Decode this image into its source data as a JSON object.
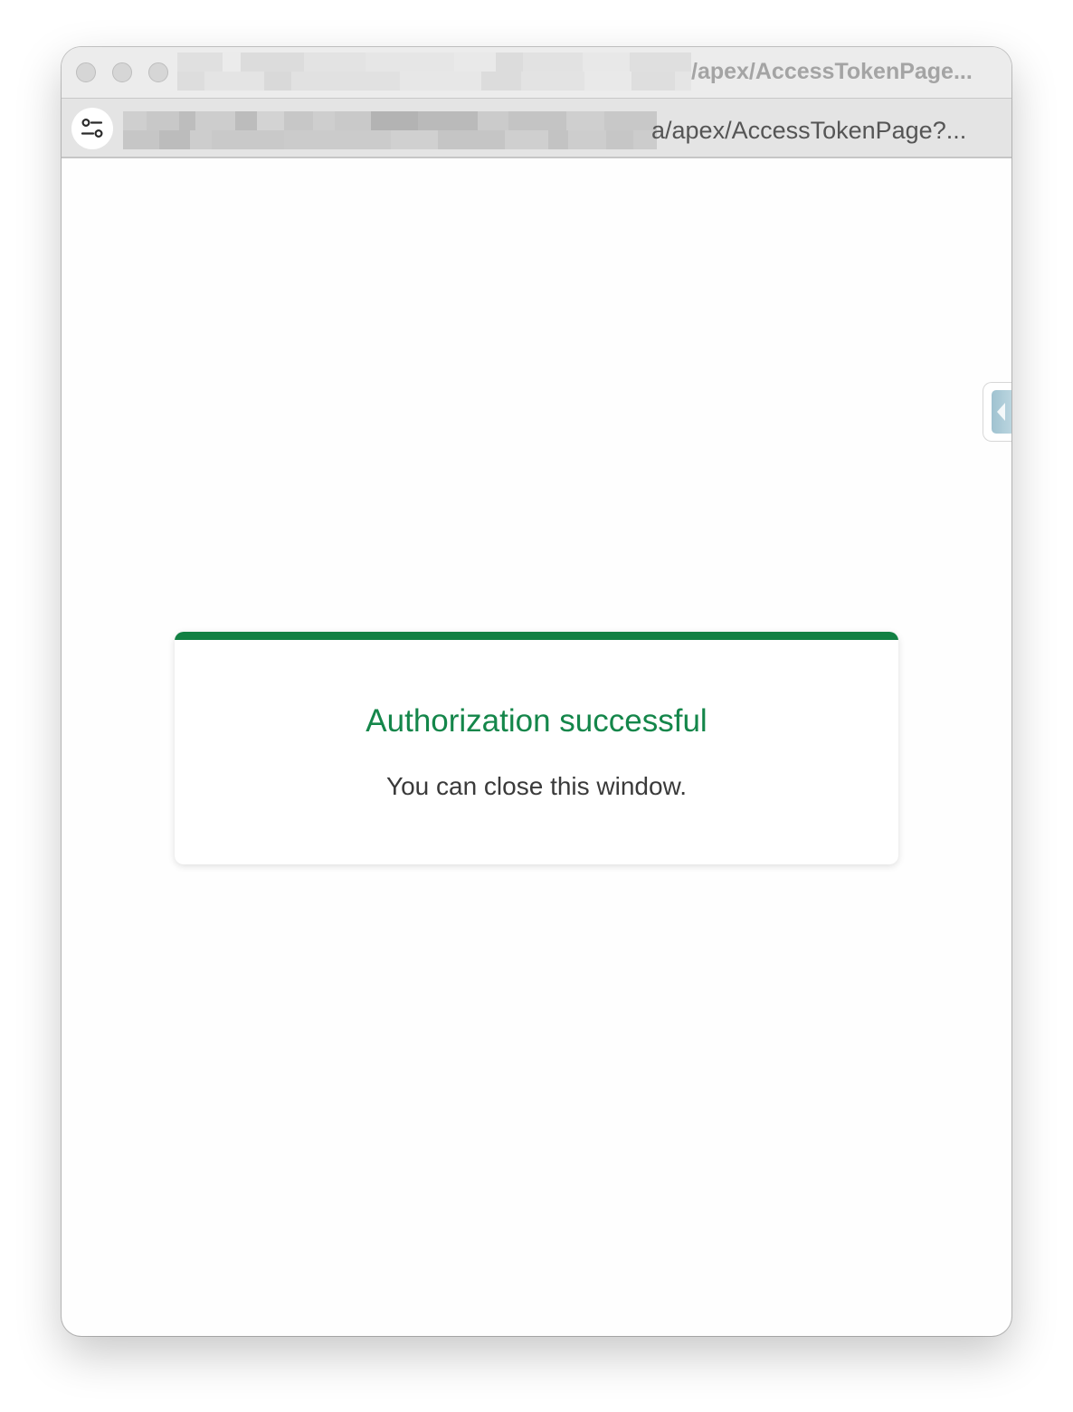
{
  "window": {
    "title_suffix": "/apex/AccessTokenPage...",
    "traffic_lights": [
      "close",
      "minimize",
      "zoom"
    ]
  },
  "address_bar": {
    "url_suffix": "a/apex/AccessTokenPage?...",
    "site_settings_icon": "sliders-icon"
  },
  "side_panel": {
    "icon": "chevron-left-icon"
  },
  "message_card": {
    "title": "Authorization successful",
    "body": "You can close this window.",
    "accent_color": "#128043",
    "title_color": "#14864a"
  }
}
